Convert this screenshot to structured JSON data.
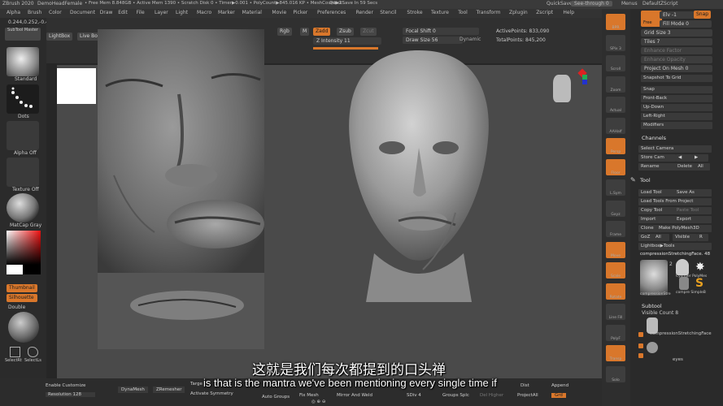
{
  "titlebar": {
    "app": "ZBrush 2020",
    "doc": "DemoHeadFemale",
    "stats": "• Free Mem 8.848GB • Active Mem 1390 • Scratch Disk 0 • Timer▶0.001 • PolyCount▶845.016 KP • MeshCount▶2",
    "quicksave_timer": "QuickSave In 59 Secs",
    "quicksave": "QuickSave",
    "seethrough": "See-through 0",
    "menus": "Menus",
    "script": "DefaultZScript"
  },
  "menubar": {
    "items": [
      "Alpha",
      "Brush",
      "Color",
      "Document",
      "Draw",
      "Edit",
      "File",
      "Layer",
      "Light",
      "Macro",
      "Marker",
      "Material",
      "Movie",
      "Picker",
      "Preferences",
      "Render",
      "Stencil",
      "Stroke",
      "Texture",
      "Tool",
      "Transform",
      "Zplugin",
      "Zscript",
      "Help"
    ]
  },
  "coords": "0.244,0.252,-0.446",
  "toolbar": {
    "subtool_master": "SubTool Master",
    "lightbox": "LightBox",
    "live_boolean": "Live Boo",
    "rgb": "Rgb",
    "m": "M",
    "zadd": "Zadd",
    "zsub": "Zsub",
    "zcut": "Zcut",
    "z_intensity": "Z Intensity 11",
    "focal_shift": "Focal Shift 0",
    "draw_size": "Draw Size 56",
    "dynamic": "Dynamic",
    "active_points": "ActivePoints: 833,090",
    "total_points": "TotalPoints: 845,200"
  },
  "leftshelf": {
    "standard": "Standard",
    "dots": "Dots",
    "alpha_off": "Alpha Off",
    "texture_off": "Texture Off",
    "matcap": "MatCap Gray",
    "thumbnail": "Thumbnail",
    "silhouette": "Silhouette",
    "double": "Double",
    "selectrect": "SelectRt",
    "selectlasso": "SelectLs"
  },
  "rightstrip": {
    "items": [
      "BPR",
      "SPix 3",
      "Scroll",
      "Zoom",
      "Actual",
      "AAHalf",
      "Persp",
      "Floor",
      "L.Sym",
      "Gxyz",
      "Frame",
      "Move",
      "Scale",
      "Rotate",
      "Line Fill",
      "PolyF",
      "Transp",
      "Solo"
    ],
    "colors": {
      "accent": "#d9772b"
    }
  },
  "rightpanel": {
    "elv": "Elv -1",
    "snap": "Snap",
    "free": "Free",
    "fill_mode": "Fill Mode 0",
    "grid_size": "Grid Size 3",
    "tiles": "Tiles 7",
    "enhance_factor": "Enhance Factor",
    "enhance_opacity": "Enhance Opacity",
    "project_on_mesh": "Project On Mesh 0",
    "snapshot_to_grid": "Snapshot To Grid",
    "views": [
      "Snap",
      "Front-Back",
      "Up-Down",
      "Left-Right",
      "Modifiers"
    ],
    "channels_title": "Channels",
    "select_camera": "Select Camera",
    "store_cam": "Store Cam",
    "rename": "Rename",
    "delete": "Delete",
    "all": "All",
    "tool_title": "Tool",
    "load_tool": "Load Tool",
    "save_as": "Save As",
    "load_from_project": "Load Tools From Project",
    "copy_tool": "Copy Tool",
    "paste_tool": "Paste Tool",
    "import": "Import",
    "export": "Export",
    "clone": "Clone",
    "make_polymesh": "Make PolyMesh3D",
    "goz": "GoZ",
    "all2": "All",
    "visible": "Visible",
    "r": "R",
    "lightbox_tools": "Lightbox▶Tools",
    "current_tool": "compressionStretchingFace. 48",
    "thumb_count": "2",
    "thumb_labels": [
      "compressionStre",
      "Cylinder PolyMes",
      "compre SimpleB"
    ],
    "subtool_title": "Subtool",
    "visible_count": "Visible Count 8",
    "subtool_items": [
      "compressionStretchingFace",
      "eyes"
    ]
  },
  "bottombar": {
    "enable_customize": "Enable Customize",
    "resolution": "Resolution 128",
    "dynamesh": "DynaMesh",
    "zremesher": "ZRemesher",
    "target": "Targe",
    "activate_symmetry": "Activate Symmetry",
    "auto_groups": "Auto Groups",
    "fix_mesh": "Fix Mesh",
    "mirror_and_weld": "Mirror And Weld",
    "sdiv": "SDiv 4",
    "groups_split": "Groups Splc",
    "del_higher": "Del Higher",
    "project_all": "ProjectAll",
    "dist": "Dist",
    "append": "Append",
    "grd": "Grd",
    "zoom": "Zoom"
  },
  "subtitles": {
    "zh": "这就是我们每次都提到的口头禅",
    "en": "is that is the mantra we've been mentioning every single time if"
  },
  "colors": {
    "bg": "#262626",
    "viewport": "#4a4a4a",
    "orange": "#d9772b"
  }
}
